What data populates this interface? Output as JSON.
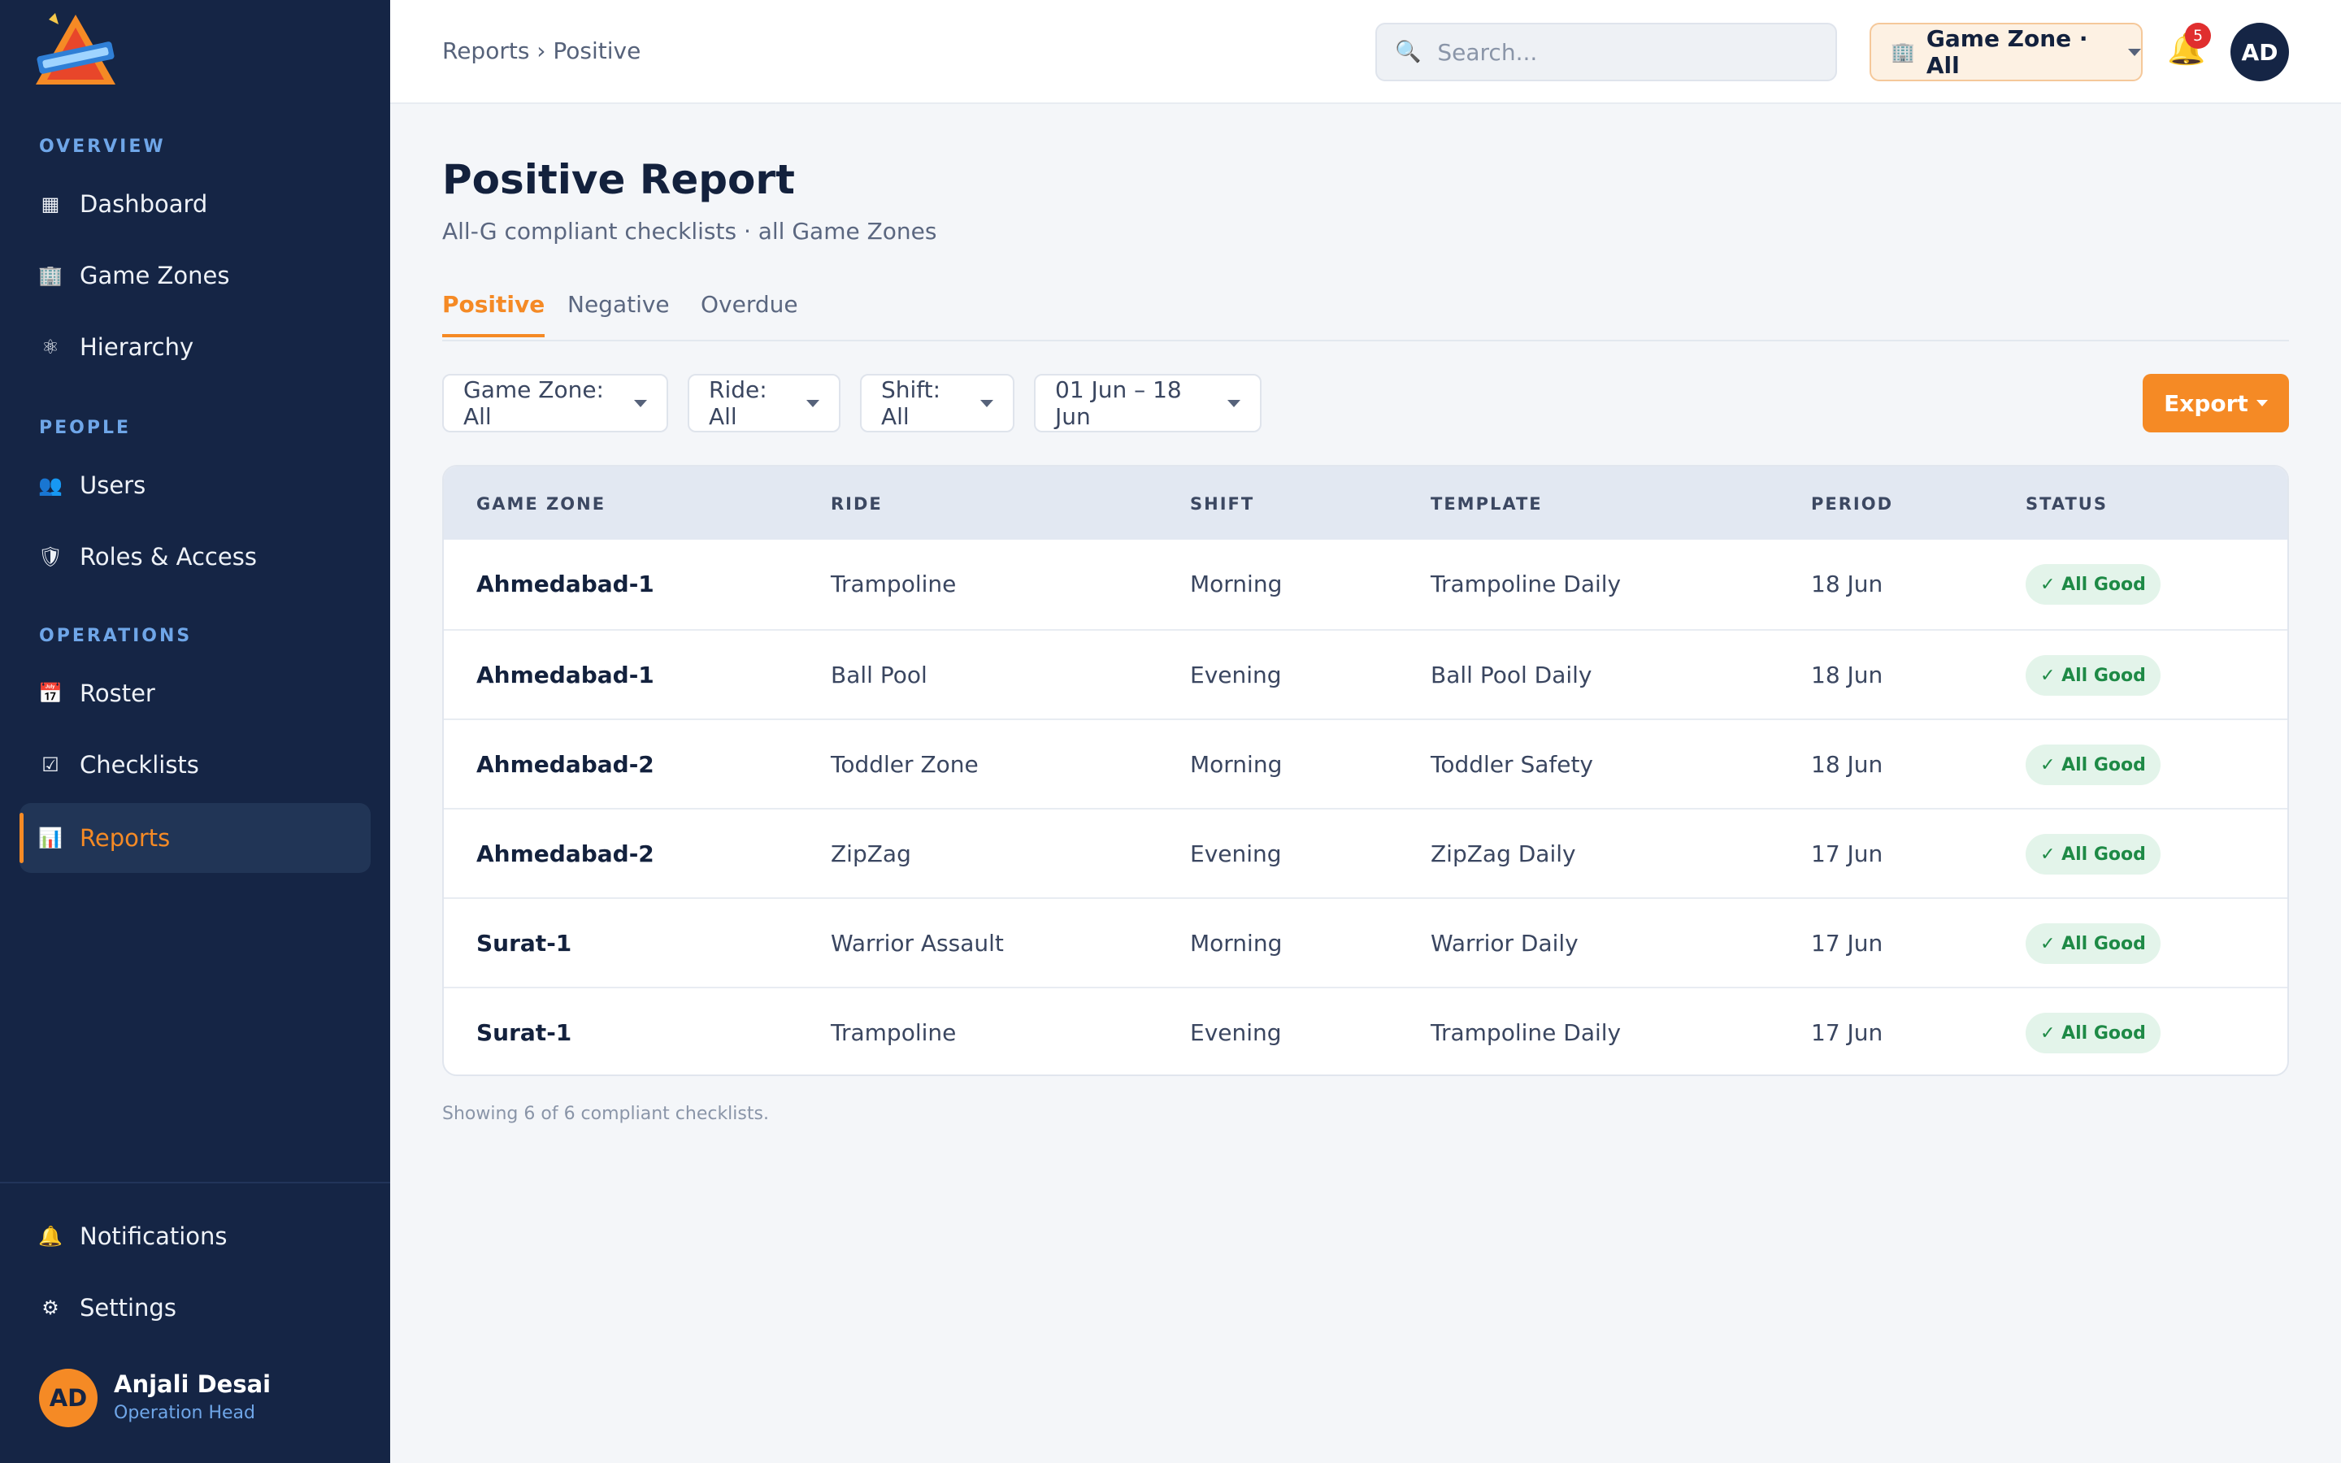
{
  "sidebar": {
    "sections": [
      {
        "title": "OVERVIEW",
        "items": [
          {
            "label": "Dashboard",
            "icon": "dashboard-icon",
            "glyph": "▦"
          },
          {
            "label": "Game Zones",
            "icon": "building-icon",
            "glyph": "🏢"
          },
          {
            "label": "Hierarchy",
            "icon": "hierarchy-icon",
            "glyph": "⚛"
          }
        ]
      },
      {
        "title": "PEOPLE",
        "items": [
          {
            "label": "Users",
            "icon": "users-icon",
            "glyph": "👥"
          },
          {
            "label": "Roles & Access",
            "icon": "shield-icon",
            "glyph": "🛡"
          }
        ]
      },
      {
        "title": "OPERATIONS",
        "items": [
          {
            "label": "Roster",
            "icon": "calendar-icon",
            "glyph": "📅"
          },
          {
            "label": "Checklists",
            "icon": "checkbox-icon",
            "glyph": "☑"
          },
          {
            "label": "Reports",
            "icon": "chart-icon",
            "glyph": "📊",
            "active": true
          }
        ]
      }
    ],
    "bottom_items": [
      {
        "label": "Notifications",
        "icon": "bell-icon",
        "glyph": "🔔"
      },
      {
        "label": "Settings",
        "icon": "gear-icon",
        "glyph": "⚙"
      }
    ],
    "user": {
      "initials": "AD",
      "name": "Anjali Desai",
      "role": "Operation Head"
    }
  },
  "header": {
    "breadcrumb": "Reports › Positive",
    "search_placeholder": "Search...",
    "zone_selector": "Game Zone · All",
    "notification_count": "5",
    "avatar_initials": "AD"
  },
  "page": {
    "title": "Positive Report",
    "subtitle": "All-G compliant checklists · all Game Zones",
    "tabs": [
      {
        "label": "Positive",
        "active": true
      },
      {
        "label": "Negative"
      },
      {
        "label": "Overdue"
      }
    ],
    "filters": [
      {
        "label": "Game Zone: All"
      },
      {
        "label": "Ride: All"
      },
      {
        "label": "Shift: All"
      },
      {
        "label": "01 Jun – 18 Jun"
      }
    ],
    "export_label": "Export",
    "footer_note": "Showing 6 of 6 compliant checklists."
  },
  "table": {
    "columns": [
      "GAME ZONE",
      "RIDE",
      "SHIFT",
      "TEMPLATE",
      "PERIOD",
      "STATUS"
    ],
    "rows": [
      [
        "Ahmedabad-1",
        "Trampoline",
        "Morning",
        "Trampoline Daily",
        "18 Jun",
        "✓ All Good"
      ],
      [
        "Ahmedabad-1",
        "Ball Pool",
        "Evening",
        "Ball Pool Daily",
        "18 Jun",
        "✓ All Good"
      ],
      [
        "Ahmedabad-2",
        "Toddler Zone",
        "Morning",
        "Toddler Safety",
        "18 Jun",
        "✓ All Good"
      ],
      [
        "Ahmedabad-2",
        "ZipZag",
        "Evening",
        "ZipZag Daily",
        "17 Jun",
        "✓ All Good"
      ],
      [
        "Surat-1",
        "Warrior Assault",
        "Morning",
        "Warrior Daily",
        "17 Jun",
        "✓ All Good"
      ],
      [
        "Surat-1",
        "Trampoline",
        "Evening",
        "Trampoline Daily",
        "17 Jun",
        "✓ All Good"
      ]
    ]
  },
  "colors": {
    "sidebar_bg": "#152545",
    "accent": "#f58a25",
    "status_good": "#1e8a46"
  }
}
